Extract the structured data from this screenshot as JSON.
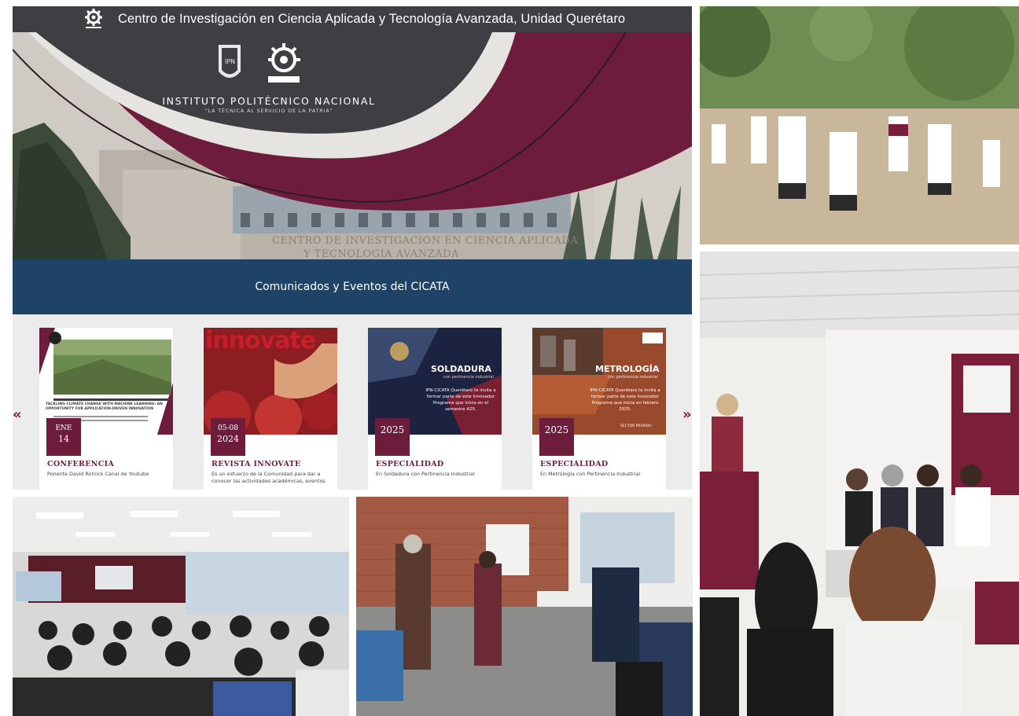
{
  "site": {
    "header_title": "Centro de Investigación en Ciencia Aplicada y Tecnología Avanzada, Unidad Querétaro",
    "institution_name": "INSTITUTO POLITÉCNICO NACIONAL",
    "institution_motto": "\"LA TÉCNICA AL SERVICIO DE LA PATRIA\"",
    "building_sign_line1": "CENTRO DE INVESTIGACION EN CIENCIA APLICADA",
    "building_sign_line2": "Y TECNOLOGIA AVANZADA",
    "section_title": "Comunicados y Eventos del CICATA",
    "carousel": {
      "prev": "«",
      "next": "»",
      "cards": [
        {
          "date_top": "ENE",
          "date_bottom": "14",
          "kind": "CONFERENCIA",
          "desc": "Ponente David Rolnick Canal de Youtube",
          "thumb_text": "TACKLING CLIMATE CHANGE WITH MACHINE LEARNING: AN OPPORTUNITY FOR APPLICATION-DRIVEN INNOVATION"
        },
        {
          "date_top": "05-08",
          "date_bottom": "2024",
          "kind": "REVISTA INNOVATE",
          "desc": "Es un esfuerzo de la Comunidad para dar a conocer las actividades académicas, eventos",
          "thumb_text": "innovate"
        },
        {
          "date_top": "",
          "date_bottom": "2025",
          "kind": "ESPECIALIDAD",
          "desc": "En Soldadura con Pertinencia Industrial",
          "thumb_title": "SOLDADURA",
          "thumb_sub": "con pertinencia industrial",
          "thumb_invite": "IPN-CICATA Querétaro te invita a formar parte de este Innovador Programa que inicia en el semestre A25."
        },
        {
          "date_top": "",
          "date_bottom": "2025",
          "kind": "ESPECIALIDAD",
          "desc": "En Metrología con Pertinencia Industrial",
          "thumb_title": "METROLOGÍA",
          "thumb_sub": "con pertinencia industrial",
          "thumb_invite": "IPN-CICATA Querétaro te invita a formar parte de este Innovador Programa que inicia en febrero 2025.",
          "thumb_foot": "SECTOR PRIVADO"
        }
      ]
    }
  },
  "colors": {
    "maroon": "#6d1d3b",
    "navy": "#1e4366",
    "charcoal": "#3f3e42"
  }
}
